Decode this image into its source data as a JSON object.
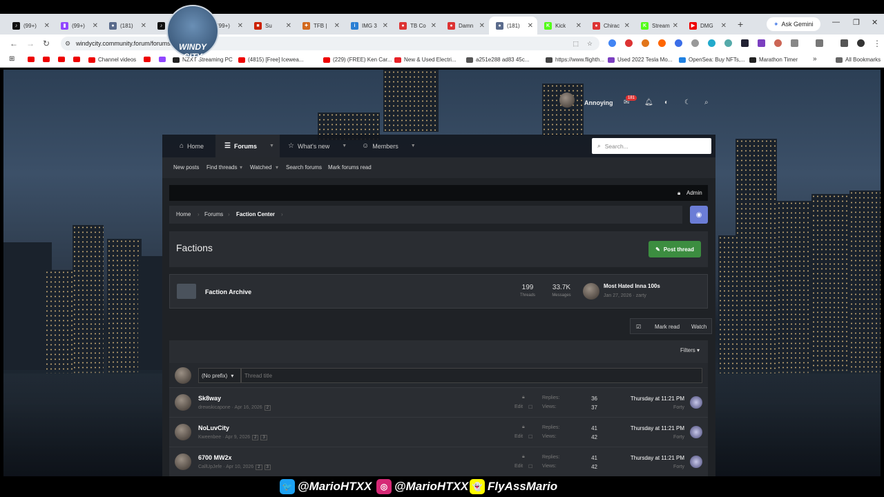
{
  "browser": {
    "tabs": [
      {
        "label": "(99+) ",
        "color": "#111111",
        "glyph": "♪"
      },
      {
        "label": "(99+) ",
        "color": "#9146ff",
        "glyph": "▮"
      },
      {
        "label": "(181) ",
        "color": "#5a6b8c",
        "glyph": "●"
      },
      {
        "label": "(99+) ",
        "color": "#111111",
        "glyph": "♪"
      },
      {
        "label": "(99+) ",
        "color": "#111111",
        "glyph": "♪"
      },
      {
        "label": "Su",
        "color": "#cc2200",
        "glyph": "■"
      },
      {
        "label": "TFB | ",
        "color": "#d2691e",
        "glyph": "✦"
      },
      {
        "label": "IMG 3",
        "color": "#2a7fd4",
        "glyph": "i"
      },
      {
        "label": "TB Co",
        "color": "#d33",
        "glyph": "●"
      },
      {
        "label": "Damn",
        "color": "#d33",
        "glyph": "●"
      },
      {
        "label": "(181)",
        "color": "#5a6b8c",
        "glyph": "●"
      },
      {
        "label": "Kick",
        "color": "#53fc18",
        "glyph": "K"
      },
      {
        "label": "Chirac",
        "color": "#d33",
        "glyph": "●"
      },
      {
        "label": "Stream",
        "color": "#53fc18",
        "glyph": "K"
      },
      {
        "label": "DMG",
        "color": "#e00",
        "glyph": "▶"
      }
    ],
    "active_tab_index": 10,
    "new_tab": "+",
    "gemini_label": "Ask Gemini",
    "url": "windycity.community.forum/forums/factions.13/",
    "bookmarks": [
      {
        "label": "",
        "color": "#e00"
      },
      {
        "label": "",
        "color": "#e00"
      },
      {
        "label": "",
        "color": "#e00"
      },
      {
        "label": "",
        "color": "#e00"
      },
      {
        "label": "Channel videos",
        "color": "#e00"
      },
      {
        "label": "",
        "color": "#e00"
      },
      {
        "label": "",
        "color": "#9146ff"
      },
      {
        "label": "NZXT Streaming PC",
        "color": "#222"
      },
      {
        "label": "(4815) [Free] Icewea...",
        "color": "#e00"
      },
      {
        "label": "(229) (FREE) Ken Car...",
        "color": "#e00"
      },
      {
        "label": "New & Used Electri...",
        "color": "#e82127"
      },
      {
        "label": "a251e288 ad83 45c...",
        "color": "#555"
      },
      {
        "label": "https://www.flighth...",
        "color": "#444"
      },
      {
        "label": "Used 2022 Tesla Mo...",
        "color": "#7b3fc0"
      },
      {
        "label": "OpenSea: Buy NFTs,...",
        "color": "#2081e2"
      },
      {
        "label": "Marathon Timer",
        "color": "#222"
      }
    ],
    "all_bookmarks": "All Bookmarks"
  },
  "header": {
    "logo_text": "WINDY CITY",
    "username": "Annoying",
    "inbox_count": "181",
    "search_placeholder": "Search..."
  },
  "nav": {
    "items": [
      {
        "label": "Home",
        "icon": "⌂"
      },
      {
        "label": "Forums",
        "icon": "☰"
      },
      {
        "label": "What's new",
        "icon": "☆"
      },
      {
        "label": "Members",
        "icon": "☺"
      }
    ],
    "sub": [
      "New posts",
      "Find threads",
      "Watched",
      "Search forums",
      "Mark forums read"
    ]
  },
  "admin_label": "Admin",
  "breadcrumb": [
    "Home",
    "Forums",
    "Faction Center"
  ],
  "page_title": "Factions",
  "post_thread": "Post thread",
  "subforum": {
    "title": "Faction Archive",
    "threads_value": "199",
    "threads_label": "Threads",
    "messages_value": "33.7K",
    "messages_label": "Messages",
    "last_title": "Most Hated Inna 100s",
    "last_meta": "Jan 27, 2026 · zarty"
  },
  "actions": {
    "mark_read": "Mark read",
    "watch": "Watch"
  },
  "filters": "Filters",
  "new_thread": {
    "prefix": "(No prefix)",
    "placeholder": "Thread title"
  },
  "threads": [
    {
      "title": "Sk8way",
      "author": "drewskicapone",
      "date": "Apr 16, 2026",
      "pages": [
        "2"
      ],
      "edit": "Edit",
      "replies_label": "Replies:",
      "replies": "36",
      "views_label": "Views:",
      "views": "37",
      "last_time": "Thursday at 11:21 PM",
      "last_by": "Forty"
    },
    {
      "title": "NoLuvCity",
      "author": "Kweenbee",
      "date": "Apr 9, 2026",
      "pages": [
        "2",
        "3"
      ],
      "edit": "Edit",
      "replies_label": "Replies:",
      "replies": "41",
      "views_label": "Views:",
      "views": "42",
      "last_time": "Thursday at 11:21 PM",
      "last_by": "Forty"
    },
    {
      "title": "6700 MW2x",
      "author": "CallUpJefe",
      "date": "Apr 10, 2026",
      "pages": [
        "2",
        "3"
      ],
      "edit": "Edit",
      "replies_label": "Replies:",
      "replies": "41",
      "views_label": "Views:",
      "views": "42",
      "last_time": "Thursday at 11:21 PM",
      "last_by": "Forty"
    }
  ],
  "social": [
    {
      "handle": "@MarioHTXX",
      "icon": "twitter-icon",
      "color": "#1da1f2",
      "glyph": "🐦"
    },
    {
      "handle": "@MarioHTXX",
      "icon": "instagram-icon",
      "color": "#d62976",
      "glyph": "◎"
    },
    {
      "handle": "FlyAssMario",
      "icon": "snapchat-icon",
      "color": "#fffc00",
      "glyph": "👻"
    }
  ]
}
